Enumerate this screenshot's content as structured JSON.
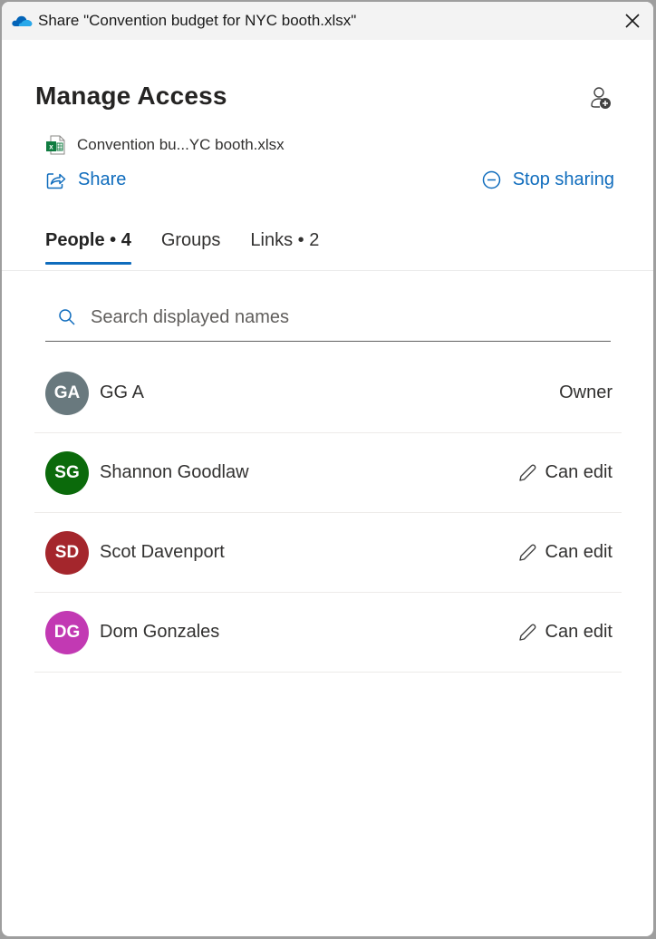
{
  "window": {
    "title": "Share \"Convention budget for NYC booth.xlsx\"",
    "app_icon": "onedrive-cloud-icon",
    "close_icon": "close-icon"
  },
  "header": {
    "title": "Manage Access",
    "add_people_icon": "add-person-icon"
  },
  "file": {
    "icon": "excel-file-icon",
    "name": "Convention bu...YC booth.xlsx"
  },
  "actions": {
    "share_label": "Share",
    "stop_sharing_label": "Stop sharing"
  },
  "tabs": [
    {
      "label": "People • 4",
      "active": true
    },
    {
      "label": "Groups",
      "active": false
    },
    {
      "label": "Links • 2",
      "active": false
    }
  ],
  "search": {
    "placeholder": "Search displayed names",
    "value": ""
  },
  "people": [
    {
      "initials": "GA",
      "name": "GG A",
      "role": "Owner",
      "avatar_color": "#69797e",
      "editable": false
    },
    {
      "initials": "SG",
      "name": "Shannon Goodlaw",
      "role": "Can edit",
      "avatar_color": "#0b6a0b",
      "editable": true
    },
    {
      "initials": "SD",
      "name": "Scot Davenport",
      "role": "Can edit",
      "avatar_color": "#a4262c",
      "editable": true
    },
    {
      "initials": "DG",
      "name": "Dom Gonzales",
      "role": "Can edit",
      "avatar_color": "#c239b3",
      "editable": true
    }
  ],
  "colors": {
    "accent": "#0f6cbd",
    "titlebar": "#f3f3f3"
  }
}
